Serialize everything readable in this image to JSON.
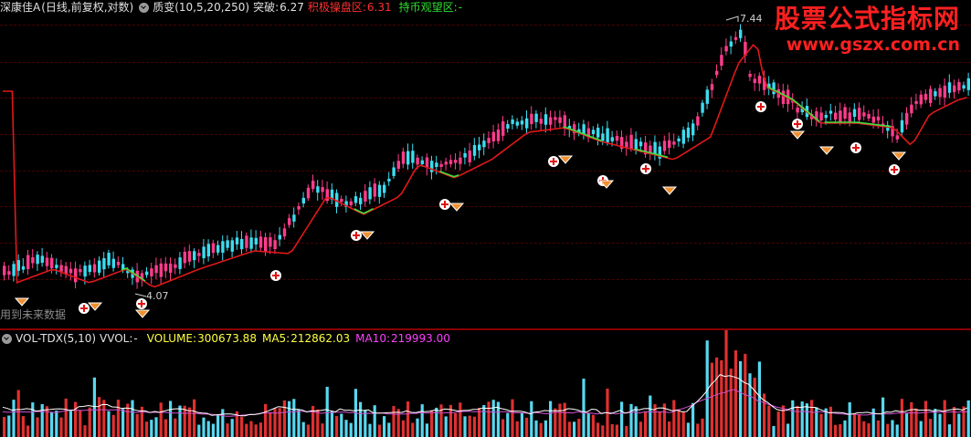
{
  "main_legend": {
    "stock_name": "深康佳A",
    "chart_mode": "(日线,前复权,对数)",
    "indicator_name": "质变(10,5,20,250)",
    "breakout_label": "突破:",
    "breakout_value": "6.27",
    "active_zone_label": "积极操盘区:",
    "active_zone_value": "6.31",
    "hold_zone_label": "持币观望区:",
    "hold_zone_value": "-"
  },
  "volume_legend": {
    "indicator_name": "VOL-TDX(5,10)",
    "vvol_label": "VVOL:",
    "vvol_value": "-",
    "volume_label": "VOLUME:",
    "volume_value": "300673.88",
    "ma5_label": "MA5:",
    "ma5_value": "212862.03",
    "ma10_label": "MA10:",
    "ma10_value": "219993.00"
  },
  "annotations": {
    "high_price": "7.44",
    "low_price": "4.07",
    "future_data_note": "用到未来数据"
  },
  "watermark": {
    "title": "股票公式指标网",
    "url": "www.gszx.com.cn"
  },
  "colors": {
    "background": "#000000",
    "candle_up": "#ff3c8c",
    "candle_down": "#3cdcf0",
    "ma_line": "#e01818",
    "ma_green": "#40e040",
    "vol_up": "#e03030",
    "vol_down": "#58d8f0",
    "vol_ma5": "#ffffff",
    "vol_ma10": "#d050d0",
    "active_zone": "#ff3030",
    "hold_zone": "#30e030",
    "volume_text": "#ffff40",
    "ma5_text": "#ffff40",
    "ma10_text": "#ff40ff"
  },
  "icons": {
    "buy_signal": "plus-circle-icon",
    "sell_signal": "diamond-icon",
    "legend_toggle": "circle-chevron-icon"
  }
}
